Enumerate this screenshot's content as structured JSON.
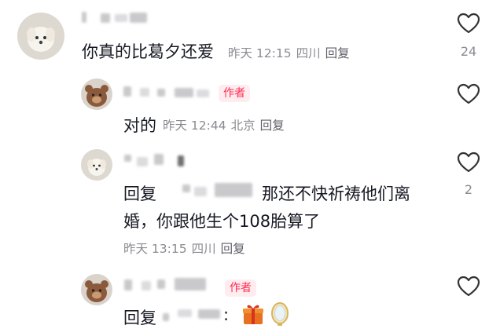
{
  "comments": [
    {
      "text": "你真的比葛夕还爱",
      "meta": {
        "time": "昨天 12:15",
        "location": "四川",
        "reply": "回复"
      },
      "like_count": "24"
    },
    {
      "author_badge": "作者",
      "text": "对的",
      "meta": {
        "time": "昨天 12:44",
        "location": "北京",
        "reply": "回复"
      },
      "like_count": ""
    },
    {
      "reply_prefix": "回复",
      "text_line1": "那还不快祈祷他们离",
      "text_line2": "婚，你跟他生个108胎算了",
      "meta": {
        "time": "昨天 13:15",
        "location": "四川",
        "reply": "回复"
      },
      "like_count": "2"
    },
    {
      "author_badge": "作者",
      "reply_prefix": "回复",
      "colon": ":",
      "emoji": [
        "🎁",
        "gift-emoji",
        "mirror-emoji"
      ],
      "like_count": ""
    }
  ],
  "colors": {
    "like_icon": "#333333",
    "author_badge_text": "#fe2c55",
    "meta_text": "#8a8b91"
  }
}
